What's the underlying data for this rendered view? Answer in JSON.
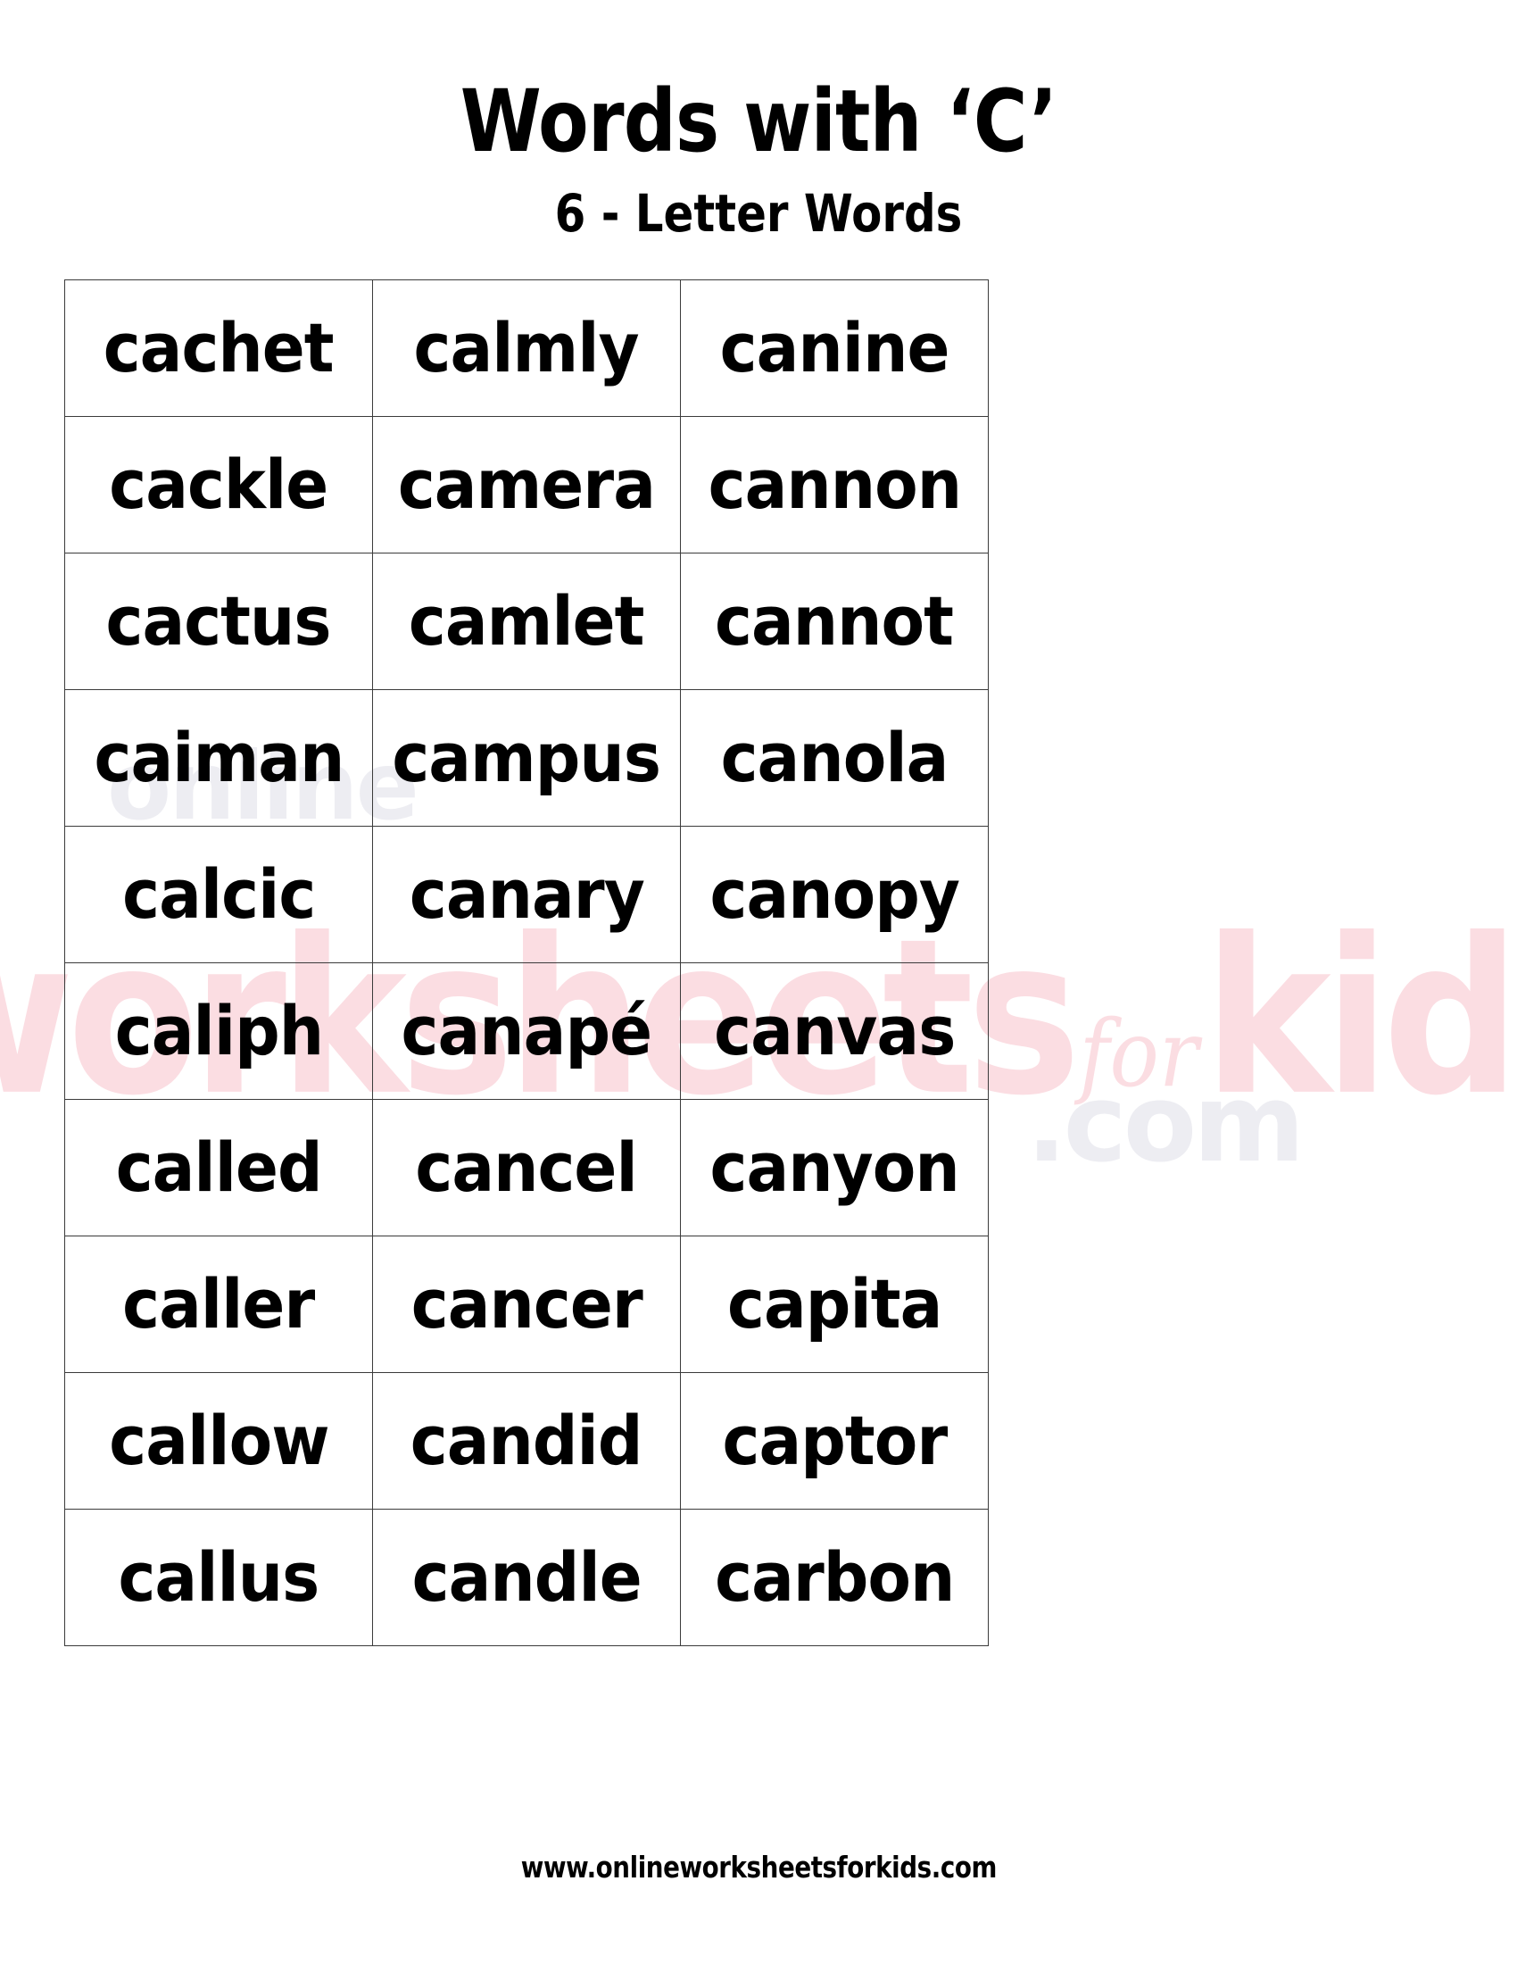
{
  "header": {
    "title": "Words with ‘C’",
    "subtitle": "6 - Letter Words"
  },
  "watermark": {
    "word1": "worksheets",
    "connector": "for",
    "word2": "kids",
    "dotcom": ".com",
    "online": "online",
    "color": "#FBDDE2",
    "faint_color": "#EDEDF2"
  },
  "table": {
    "columns": 3,
    "rows": [
      [
        "cachet",
        "calmly",
        "canine"
      ],
      [
        "cackle",
        "camera",
        "cannon"
      ],
      [
        "cactus",
        "camlet",
        "cannot"
      ],
      [
        "caiman",
        "campus",
        "canola"
      ],
      [
        "calcic",
        "canary",
        "canopy"
      ],
      [
        "caliph",
        "canapé",
        "canvas"
      ],
      [
        "called",
        "cancel",
        "canyon"
      ],
      [
        "caller",
        "cancer",
        "capita"
      ],
      [
        "callow",
        "candid",
        "captor"
      ],
      [
        "callus",
        "candle",
        "carbon"
      ]
    ],
    "border_color": "#3B3B3B"
  },
  "footer": {
    "url": "www.onlineworksheetsforkids.com"
  }
}
